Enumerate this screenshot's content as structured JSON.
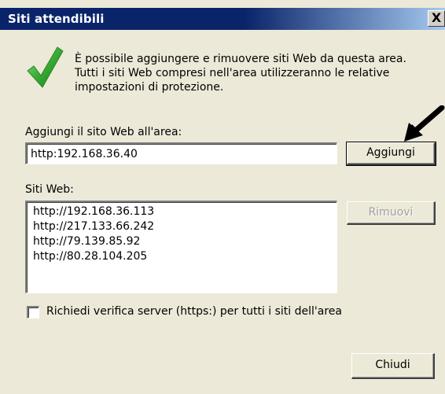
{
  "window": {
    "title": "Siti attendibili",
    "close_label": "X"
  },
  "description": {
    "line1": "È possibile aggiungere e rimuovere siti Web da questa area.",
    "line2": "Tutti i siti Web compresi nell'area utilizzeranno le relative",
    "line3": "impostazioni di protezione."
  },
  "add_site": {
    "label": "Aggiungi il sito Web all'area:",
    "value": "http:192.168.36.40",
    "button_label": "Aggiungi"
  },
  "websites": {
    "label": "Siti Web:",
    "items": [
      "http://192.168.36.113",
      "http://217.133.66.242",
      "http://79.139.85.92",
      "http://80.28.104.205"
    ],
    "remove_label": "Rimuovi"
  },
  "https_check": {
    "label": "Richiedi verifica server (https:) per tutti i siti dell'area",
    "checked": false
  },
  "footer": {
    "close_label": "Chiudi"
  },
  "icons": {
    "checkmark": "checkmark-icon",
    "annotation_arrow": "arrow-pointer-icon"
  },
  "colors": {
    "title_bar": "#0a246a",
    "dialog_bg": "#ece9d8",
    "checkmark_green": "#3aaa35"
  }
}
